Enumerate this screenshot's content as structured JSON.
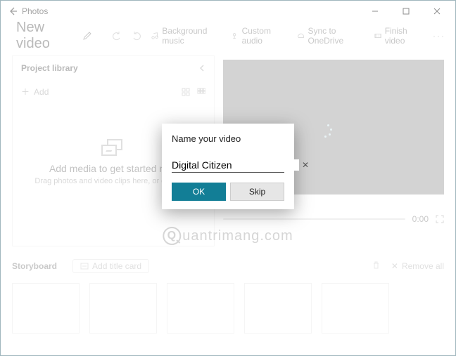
{
  "window": {
    "app_title": "Photos"
  },
  "topbar": {
    "title": "New video",
    "bg_music": "Background music",
    "custom_audio": "Custom audio",
    "sync": "Sync to OneDrive",
    "finish": "Finish video"
  },
  "library": {
    "header": "Project library",
    "add": "Add",
    "placeholder_title": "Add media to get started now",
    "placeholder_sub": "Drag photos and video clips here, or click Add"
  },
  "preview": {
    "time": "0:00"
  },
  "storyboard": {
    "header": "Storyboard",
    "add_card": "Add title card",
    "remove_all": "Remove all"
  },
  "dialog": {
    "title": "Name your video",
    "value": "Digital Citizen",
    "ok": "OK",
    "skip": "Skip"
  },
  "watermark": "uantrimang.com"
}
